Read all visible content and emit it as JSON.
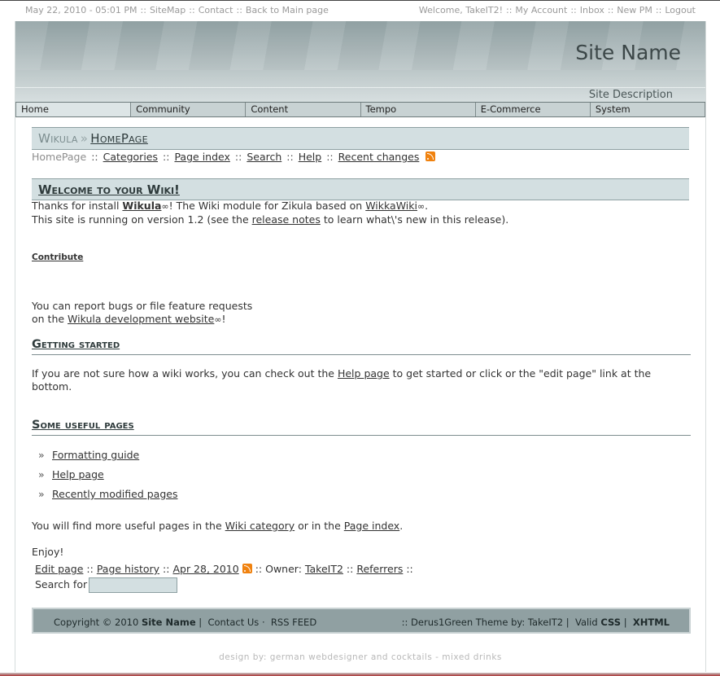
{
  "topbar": {
    "date": "May 22, 2010 - 05:01 PM",
    "sitemap": "SiteMap",
    "contact": "Contact",
    "back": "Back to Main page",
    "welcome": "Welcome, TakeIT2!",
    "account": "My Account",
    "inbox": "Inbox",
    "newpm": "New PM",
    "logout": "Logout",
    "sep": "::"
  },
  "header": {
    "site_name": "Site Name",
    "site_description": "Site Description"
  },
  "nav": {
    "tabs": [
      "Home",
      "Community",
      "Content",
      "Tempo",
      "E-Commerce",
      "System"
    ]
  },
  "wiki": {
    "module": "Wikula",
    "arrow": "»",
    "page": "HomePage",
    "current": "HomePage",
    "links": [
      "Categories",
      "Page index",
      "Search",
      "Help",
      "Recent changes"
    ],
    "sep": "::"
  },
  "welcome": {
    "heading": "Welcome to your Wiki!",
    "line1_a": "Thanks for install ",
    "line1_link": "Wikula",
    "line1_b": "! The Wiki module for Zikula based on ",
    "line1_link2": "WikkaWiki",
    "line1_c": ".",
    "line2_a": "This site is running on version 1.2 (see the ",
    "line2_link": "release notes",
    "line2_b": " to learn what\\'s new in this release).",
    "ext_symbol": "∞"
  },
  "contribute": {
    "heading": "Contribute",
    "line1": "You can report bugs or file feature requests",
    "line2_a": "on the ",
    "line2_link": "Wikula development website",
    "line2_b": "!"
  },
  "getting_started": {
    "heading": "Getting started",
    "line1_a": "If you are not sure how a wiki works, you can check out the ",
    "line1_link": "Help page",
    "line1_b": " to get started or click or the \"edit page\" link at the",
    "line2": "bottom."
  },
  "useful": {
    "heading": "Some useful pages",
    "bullet": "»",
    "items": [
      "Formatting guide",
      "Help page",
      "Recently modified pages"
    ],
    "more_a": "You will find more useful pages in the ",
    "more_link1": "Wiki category",
    "more_b": " or in the ",
    "more_link2": "Page index",
    "more_c": ".",
    "enjoy": "Enjoy!"
  },
  "page_footer": {
    "edit": "Edit page",
    "history": "Page history",
    "date": "Apr 28, 2010",
    "owner_label": "Owner:",
    "owner": "TakeIT2",
    "referrers": "Referrers",
    "search_label": "Search for",
    "sep": "::"
  },
  "footer": {
    "copyright": "Copyright © 2010",
    "site": "Site Name",
    "contact": "Contact Us",
    "rss": "RSS FEED",
    "theme": ":: Derus1Green Theme by: TakeIT2",
    "valid": "Valid",
    "css": "CSS",
    "xhtml": "XHTML",
    "pipe": "|",
    "dot": "·"
  },
  "design_by": "design by: german webdesigner and cocktails - mixed drinks",
  "colors": {
    "header": "#aab7b9",
    "title_box": "#d3dfe1",
    "footer": "#90a0a2",
    "rss": "#f0820f"
  }
}
